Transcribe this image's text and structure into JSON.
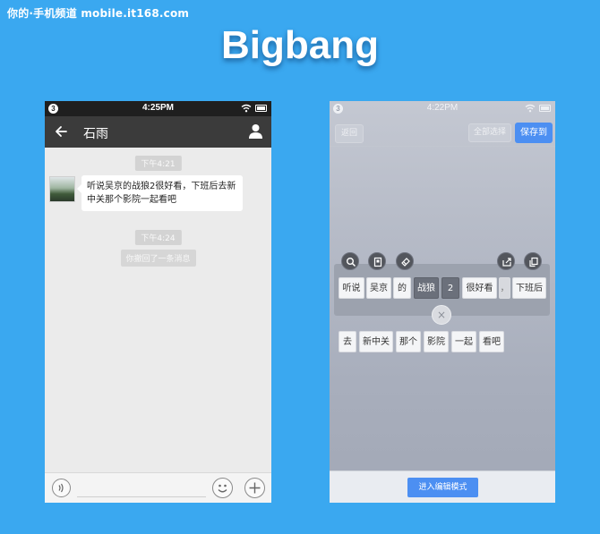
{
  "watermark": "你的·手机频道 mobile.it168.com",
  "headline": "Bigbang",
  "left_phone": {
    "status_bar": {
      "badge": "3",
      "time": "4:25PM"
    },
    "header": {
      "title": "石雨"
    },
    "timestamp_1": "下午4:21",
    "message": "听说吴京的战狼2很好看，下班后去新中关那个影院一起看吧",
    "timestamp_2": "下午4:24",
    "recall_notice": "你撤回了一条消息"
  },
  "right_phone": {
    "status_bar": {
      "badge": "3",
      "time": "4:22PM"
    },
    "toolbar": {
      "back_label": "返回",
      "select_all_label": "全部选择",
      "save_label": "保存到"
    },
    "row1_tokens": [
      "听说",
      "吴京",
      "的",
      "战狼",
      "2",
      "很好看",
      "，",
      "下班后"
    ],
    "row2_tokens": [
      "去",
      "新中关",
      "那个",
      "影院",
      "一起",
      "看吧"
    ],
    "close_symbol": "×",
    "edit_mode_label": "进入编辑模式"
  }
}
